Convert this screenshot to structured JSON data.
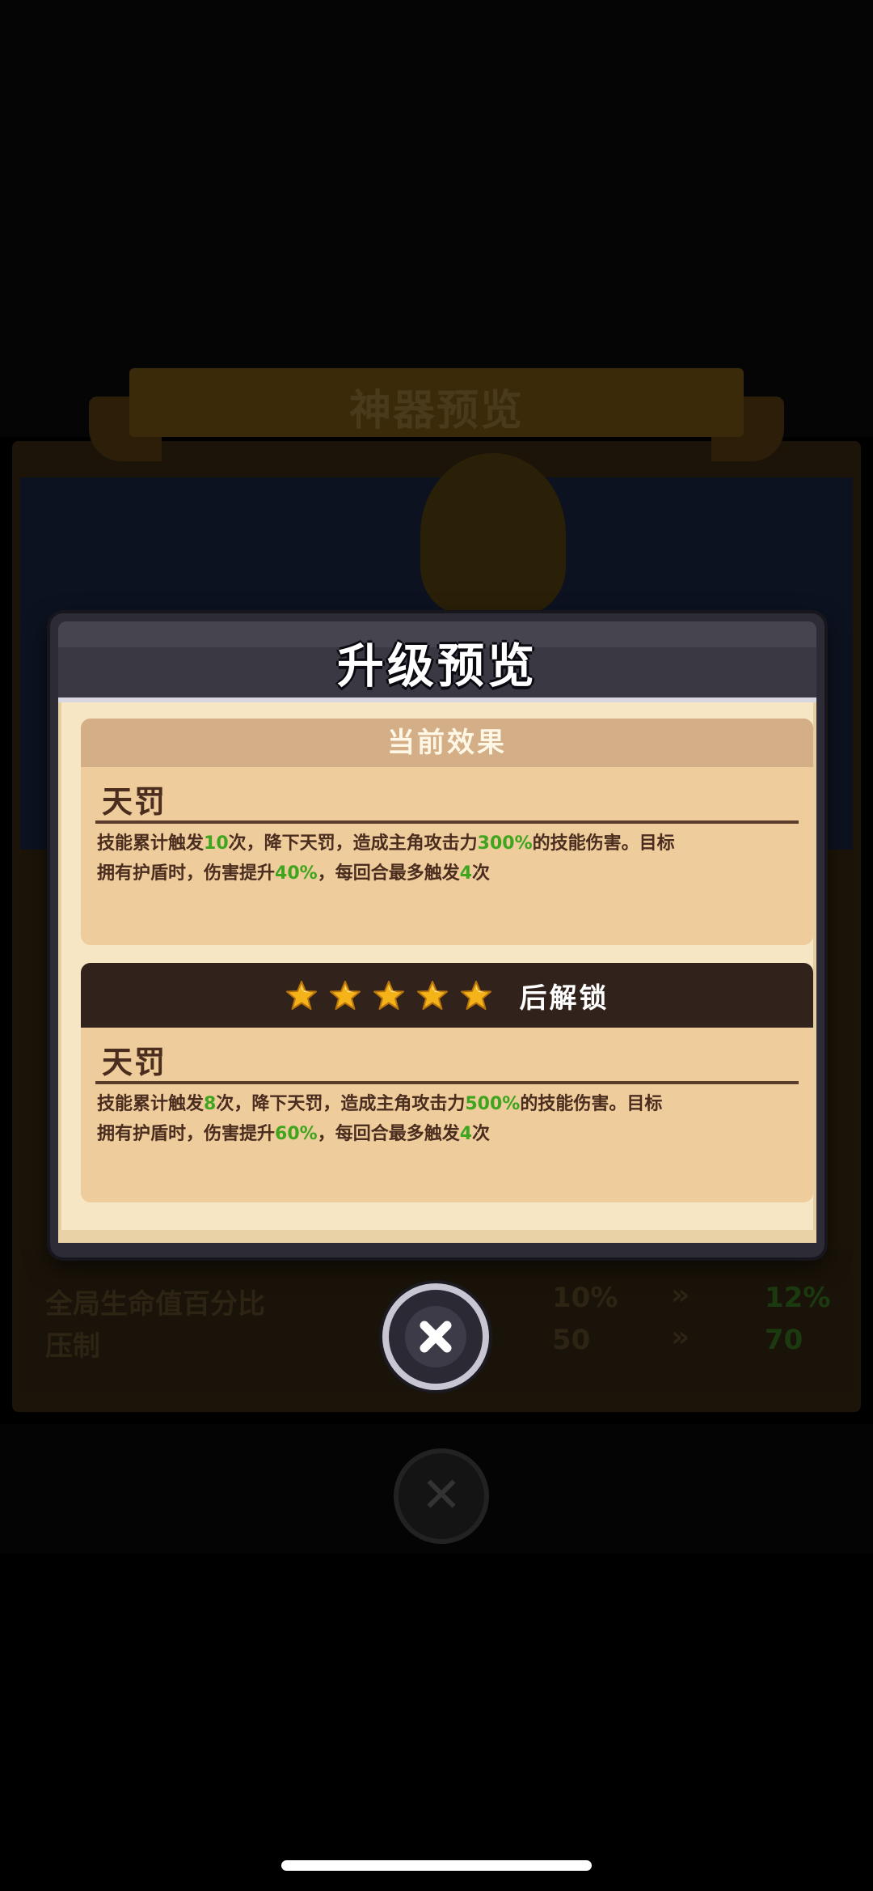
{
  "background": {
    "banner_title": "神器预览",
    "stat_rows": [
      {
        "label": "全局生命值百分比",
        "current": "10%",
        "next": "12%"
      },
      {
        "label": "压制",
        "current": "50",
        "next": "70"
      }
    ],
    "arrow_glyph": "»"
  },
  "dialog": {
    "title": "升级预览",
    "current": {
      "header": "当前效果",
      "skill_name": "天罚",
      "desc": {
        "p1": "技能累计触发",
        "v1": "10",
        "p2": "次，降下天罚，造成主角攻击力",
        "v2": "300%",
        "p3": "的技能伤害。目标",
        "p4": "拥有护盾时，伤害提升",
        "v3": "40%",
        "p5": "，每回合最多触发",
        "v4": "4",
        "p6": "次"
      }
    },
    "locked": {
      "star_count": 5,
      "header": "后解锁",
      "skill_name": "天罚",
      "desc": {
        "p1": "技能累计触发",
        "v1": "8",
        "p2": "次，降下天罚，造成主角攻击力",
        "v2": "500%",
        "p3": "的技能伤害。目标",
        "p4": "拥有护盾时，伤害提升",
        "v3": "60%",
        "p5": "，每回合最多触发",
        "v4": "4",
        "p6": "次"
      }
    },
    "colors": {
      "highlight": "#3fa51f",
      "text": "#4a2d1f",
      "card": "#eecc9b",
      "star": "#f5b31a"
    }
  }
}
